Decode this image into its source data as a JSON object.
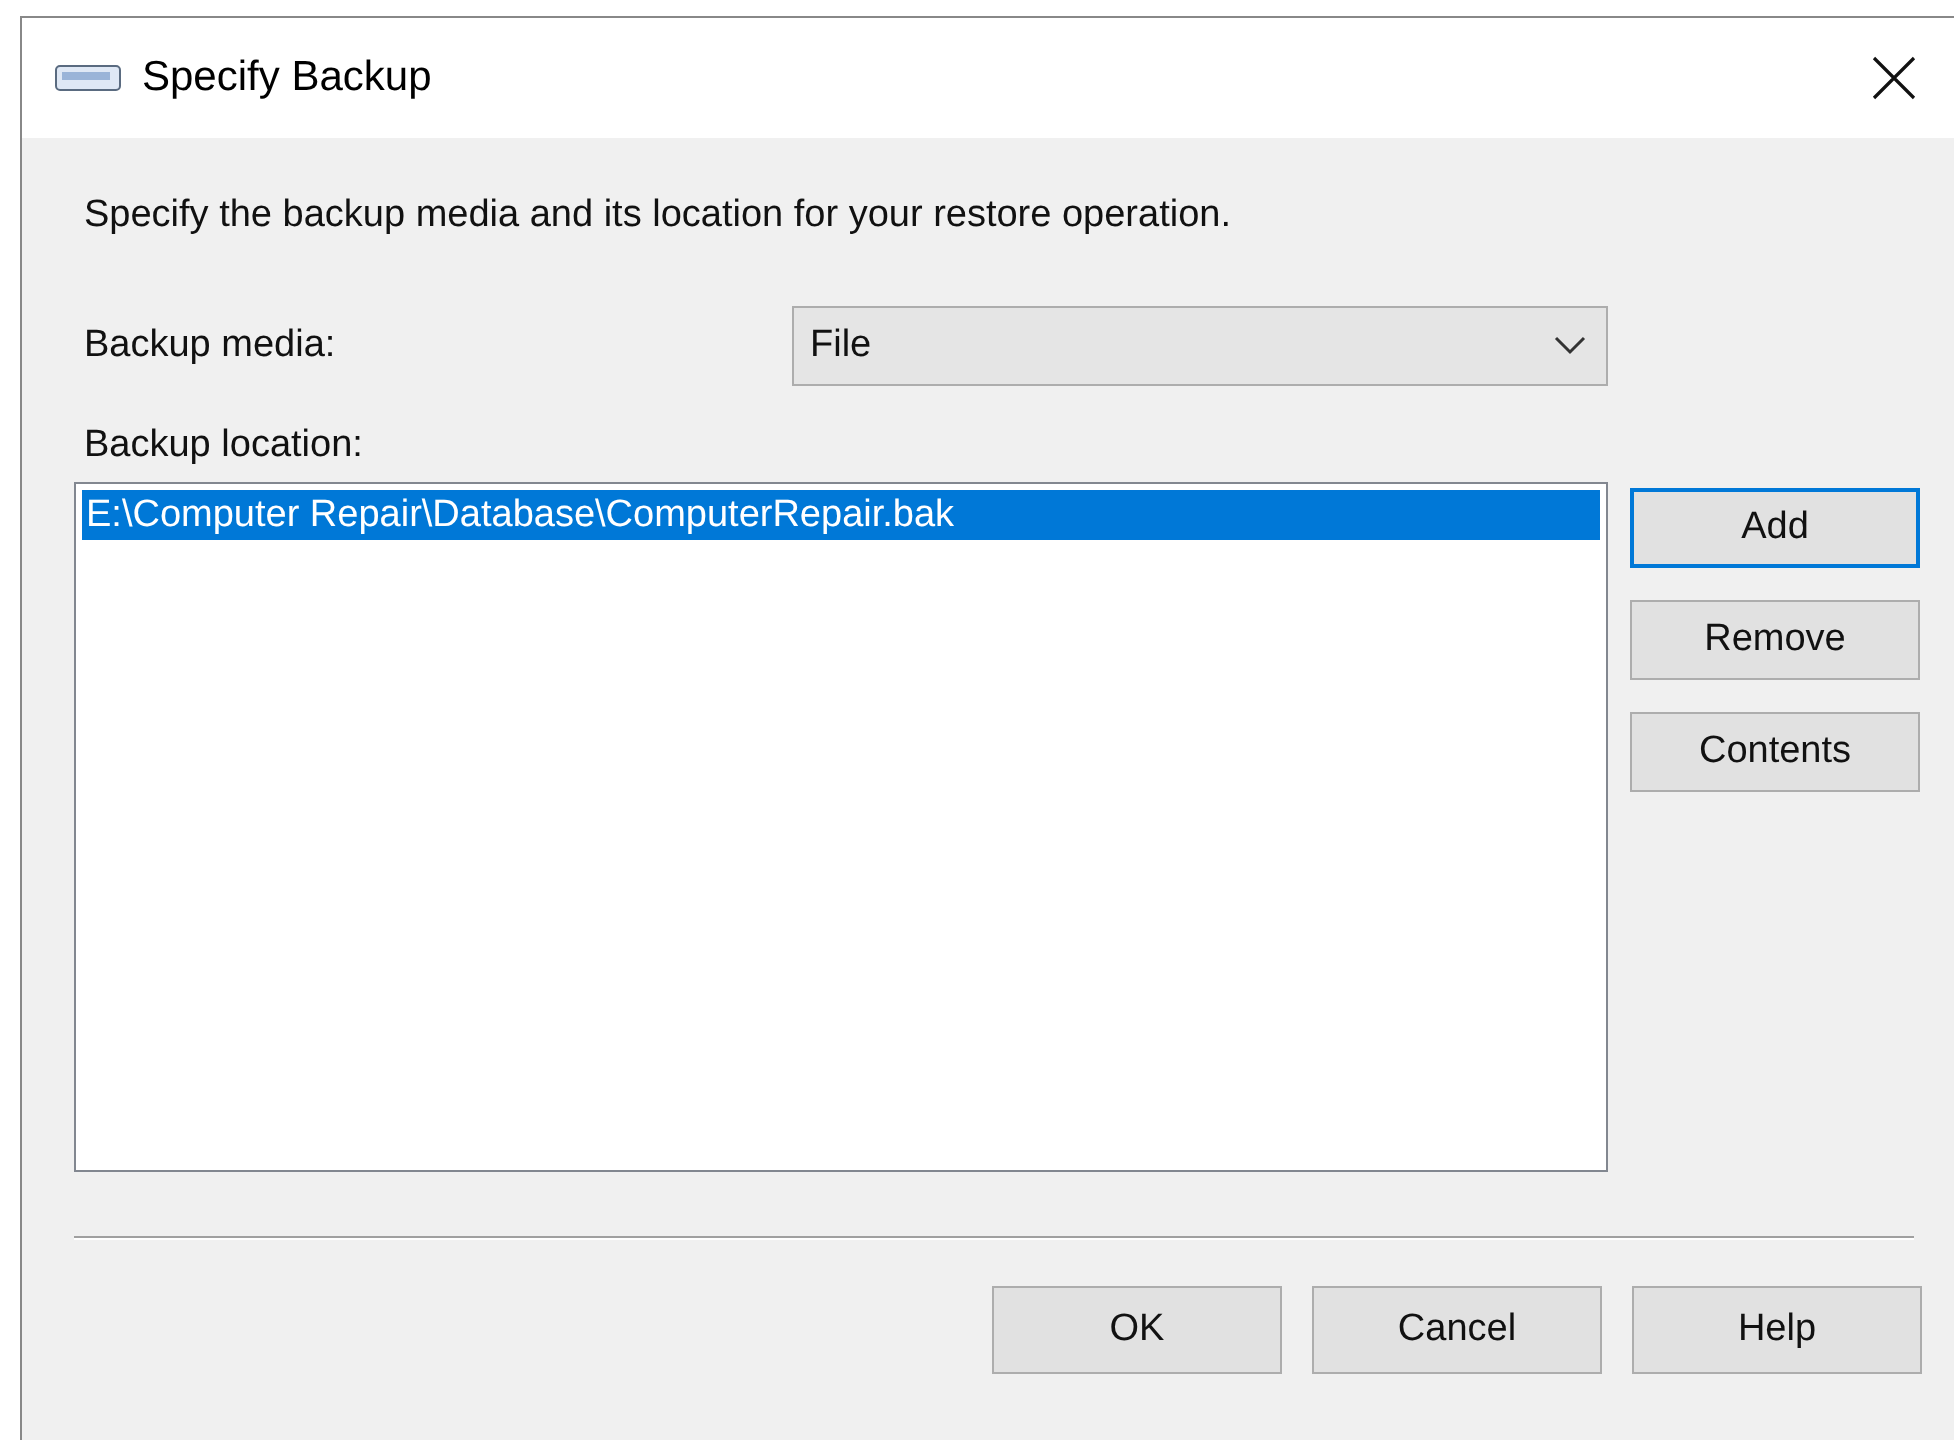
{
  "window": {
    "title": "Specify Backup"
  },
  "description": "Specify the backup media and its location for your restore operation.",
  "backup_media": {
    "label": "Backup media:",
    "value": "File"
  },
  "backup_location": {
    "label": "Backup location:",
    "items": [
      {
        "text": "E:\\Computer Repair\\Database\\ComputerRepair.bak",
        "selected": true
      }
    ]
  },
  "side_buttons": [
    {
      "label": "Add",
      "focused": true
    },
    {
      "label": "Remove",
      "focused": false
    },
    {
      "label": "Contents",
      "focused": false
    }
  ],
  "buttons": [
    "OK",
    "Cancel",
    "Help"
  ]
}
